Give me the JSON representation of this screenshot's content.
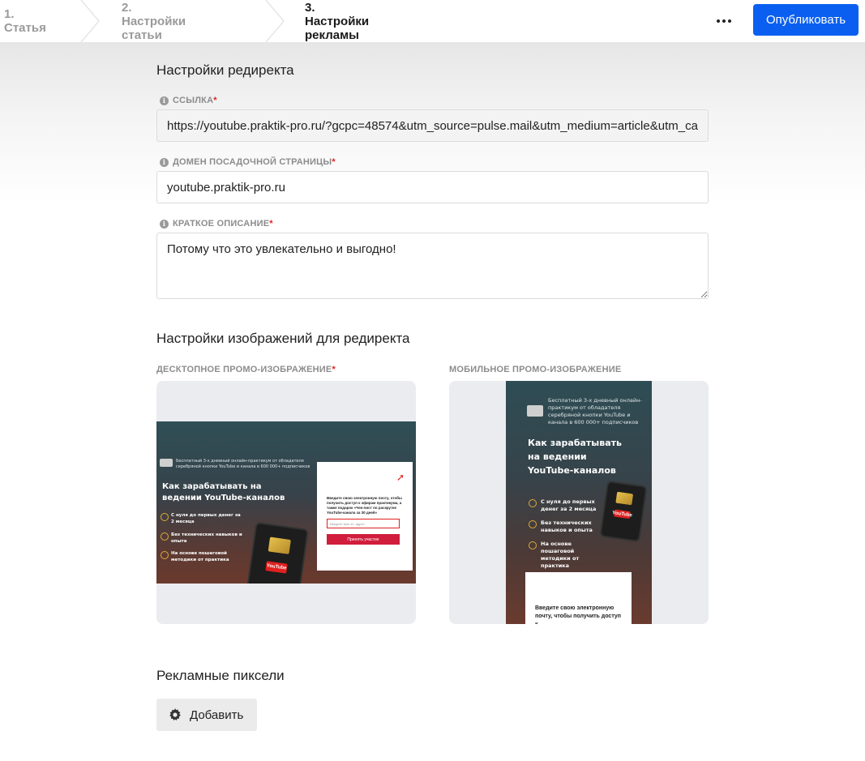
{
  "header": {
    "steps": [
      "1. Статья",
      "2. Настройки статьи",
      "3. Настройки рекламы"
    ],
    "publish_label": "Опубликовать"
  },
  "redirect": {
    "title": "Настройки редиректа",
    "link_label": "ССЫЛКА",
    "link_value": "https://youtube.praktik-pro.ru/?gcpc=48574&utm_source=pulse.mail&utm_medium=article&utm_ca",
    "domain_label": "ДОМЕН ПОСАДОЧНОЙ СТРАНИЦЫ",
    "domain_value": "youtube.praktik-pro.ru",
    "desc_label": "КРАТКОЕ ОПИСАНИЕ",
    "desc_value": "Потому что это увлекательно и выгодно!",
    "required_mark": "*"
  },
  "images": {
    "title": "Настройки изображений для редиректа",
    "desktop_label": "ДЕСКТОПНОЕ ПРОМО-ИЗОБРАЖЕНИЕ",
    "mobile_label": "МОБИЛЬНОЕ ПРОМО-ИЗОБРАЖЕНИЕ",
    "promo": {
      "intro": "Бесплатный 3-х дневный онлайн-практикум от обладателя серебряной кнопки YouTube и канала в 600 000+ подписчиков",
      "headline_desktop": "Как зарабатывать на ведении YouTube-каналов",
      "headline_mobile": "Как зарабатывать на ведении YouTube-каналов",
      "bullets": [
        "С нуля до первых денег за 2 месяца",
        "Без технических навыков и опыта",
        "На основе пошаговой методики от практика"
      ],
      "form_text": "Введите свою электронную почту, чтобы получить доступ к эфирам практикума, а также подарок «Чек-лист по раскрутке YouTube-канала за 30 дней»",
      "email_placeholder": "Введите ваш эл. адрес",
      "submit": "Принять участие",
      "mobile_form_text": "Введите свою электронную почту, чтобы получить доступ к",
      "yt": "YouTube"
    }
  },
  "pixels": {
    "title": "Рекламные пиксели",
    "add_label": "Добавить"
  }
}
